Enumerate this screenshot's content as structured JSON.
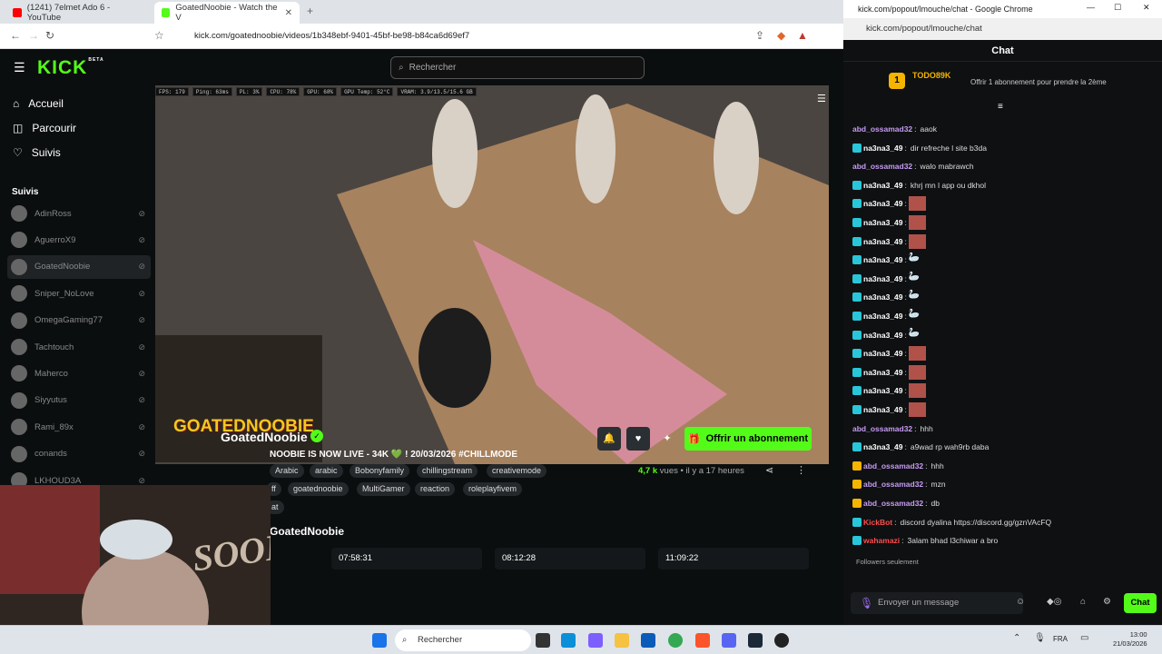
{
  "browser": {
    "tabs": [
      {
        "label": "(1241) 7elmet Ado 6 - YouTube",
        "active": false,
        "color": "#ff0000"
      },
      {
        "label": "GoatedNoobie - Watch the V",
        "active": true,
        "color": "#53fc18"
      }
    ],
    "url": "kick.com/goatednoobie/videos/1b348ebf-9401-45bf-be98-b84ca6d69ef7"
  },
  "kick": {
    "logo": "KICK",
    "logo_badge": "BETA",
    "search_placeholder": "Rechercher",
    "nav": [
      "Accueil",
      "Parcourir",
      "Suivis"
    ],
    "section_title": "Suivis",
    "following": [
      {
        "name": "AdinRoss"
      },
      {
        "name": "AguerroX9"
      },
      {
        "name": "GoatedNoobie"
      },
      {
        "name": "Sniper_NoLove"
      },
      {
        "name": "OmegaGaming77"
      },
      {
        "name": "Tachtouch"
      },
      {
        "name": "Maherco"
      },
      {
        "name": "Siyyutus"
      },
      {
        "name": "Rami_89x"
      },
      {
        "name": "conands"
      },
      {
        "name": "LKHOUD3A"
      }
    ],
    "stats": [
      "FPS: 179",
      "Ping: 63ms",
      "PL: 3%",
      "CPU: 78%",
      "GPU: 68%",
      "GPU Temp: 52°C",
      "VRAM: 3.9/13.5/15.6 GB"
    ],
    "overlay_logo": "GOATEDNOOBIE",
    "streamer": "GoatedNoobie",
    "stream_title": "NOOBIE IS NOW LIVE - 34K 💚 ! 20/03/2026 #CHILLMODE",
    "subscribe_label": "Offrir un abonnement",
    "tags": [
      "Arabic",
      "arabic",
      "Bobonyfamily",
      "chillingstream",
      "creativemode",
      "ff",
      "goatednoobie",
      "MultiGamer",
      "reaction",
      "roleplayfivem",
      "at"
    ],
    "views_count": "4,7 k",
    "views_label": "vues",
    "time_ago": "il y a 17 heures",
    "channel_heading": "GoatedNoobie",
    "vods": [
      "07:58:31",
      "08:12:28",
      "11:09:22"
    ],
    "facecam_text": "SOON"
  },
  "chat": {
    "window_title": "kick.com/popout/lmouche/chat - Google Chrome",
    "url": "kick.com/popout/lmouche/chat",
    "header": "Chat",
    "gifter_name": "TODO89K",
    "gifter_count": "1",
    "gift_text": "Offrir 1 abonnement pour prendre la 2ème",
    "messages": [
      {
        "user": "abd_ossamad32",
        "text": "aaok",
        "color": "#c79cf2"
      },
      {
        "user": "na3na3_49",
        "text": "dir refreche l site b3da",
        "color": "#ffffff"
      },
      {
        "user": "abd_ossamad32",
        "text": "walo mabrawch",
        "color": "#c79cf2"
      },
      {
        "user": "na3na3_49",
        "text": "khrj mn l app ou dkhol",
        "color": "#ffffff"
      },
      {
        "user": "na3na3_49",
        "text": "",
        "color": "#ffffff",
        "emote": true
      },
      {
        "user": "na3na3_49",
        "text": "",
        "color": "#ffffff",
        "emote": true
      },
      {
        "user": "na3na3_49",
        "text": "",
        "color": "#ffffff",
        "emote": true
      },
      {
        "user": "na3na3_49",
        "text": "",
        "color": "#ffffff",
        "emote": "w"
      },
      {
        "user": "na3na3_49",
        "text": "",
        "color": "#ffffff",
        "emote": "w"
      },
      {
        "user": "na3na3_49",
        "text": "",
        "color": "#ffffff",
        "emote": "w"
      },
      {
        "user": "na3na3_49",
        "text": "",
        "color": "#ffffff",
        "emote": "w"
      },
      {
        "user": "na3na3_49",
        "text": "",
        "color": "#ffffff",
        "emote": "w"
      },
      {
        "user": "na3na3_49",
        "text": "",
        "color": "#ffffff",
        "emote": true
      },
      {
        "user": "na3na3_49",
        "text": "",
        "color": "#ffffff",
        "emote": true
      },
      {
        "user": "na3na3_49",
        "text": "",
        "color": "#ffffff",
        "emote": true
      },
      {
        "user": "na3na3_49",
        "text": "",
        "color": "#ffffff",
        "emote": true
      },
      {
        "user": "abd_ossamad32",
        "text": "hhh",
        "color": "#c79cf2"
      },
      {
        "user": "na3na3_49",
        "text": "a9wad rp wah9rb daba",
        "color": "#ffffff"
      },
      {
        "user": "abd_ossamad32",
        "text": "hhh",
        "color": "#c79cf2"
      },
      {
        "user": "abd_ossamad32",
        "text": "mzn",
        "color": "#c79cf2"
      },
      {
        "user": "abd_ossamad32",
        "text": "db",
        "color": "#c79cf2"
      },
      {
        "user": "KickBot",
        "text": "discord dyalina https://discord.gg/gznVAcFQ",
        "color": "#ff4d4d"
      },
      {
        "user": "wahamazi",
        "text": "3alam bhad l3chiwar a bro",
        "color": "#ff4d4d"
      }
    ],
    "followers_only": "Followers seulement",
    "input_placeholder": "Envoyer un message",
    "send_label": "Chat"
  },
  "taskbar": {
    "search": "Rechercher",
    "lang": "FRA",
    "time": "13:00",
    "date": "21/03/2026"
  }
}
